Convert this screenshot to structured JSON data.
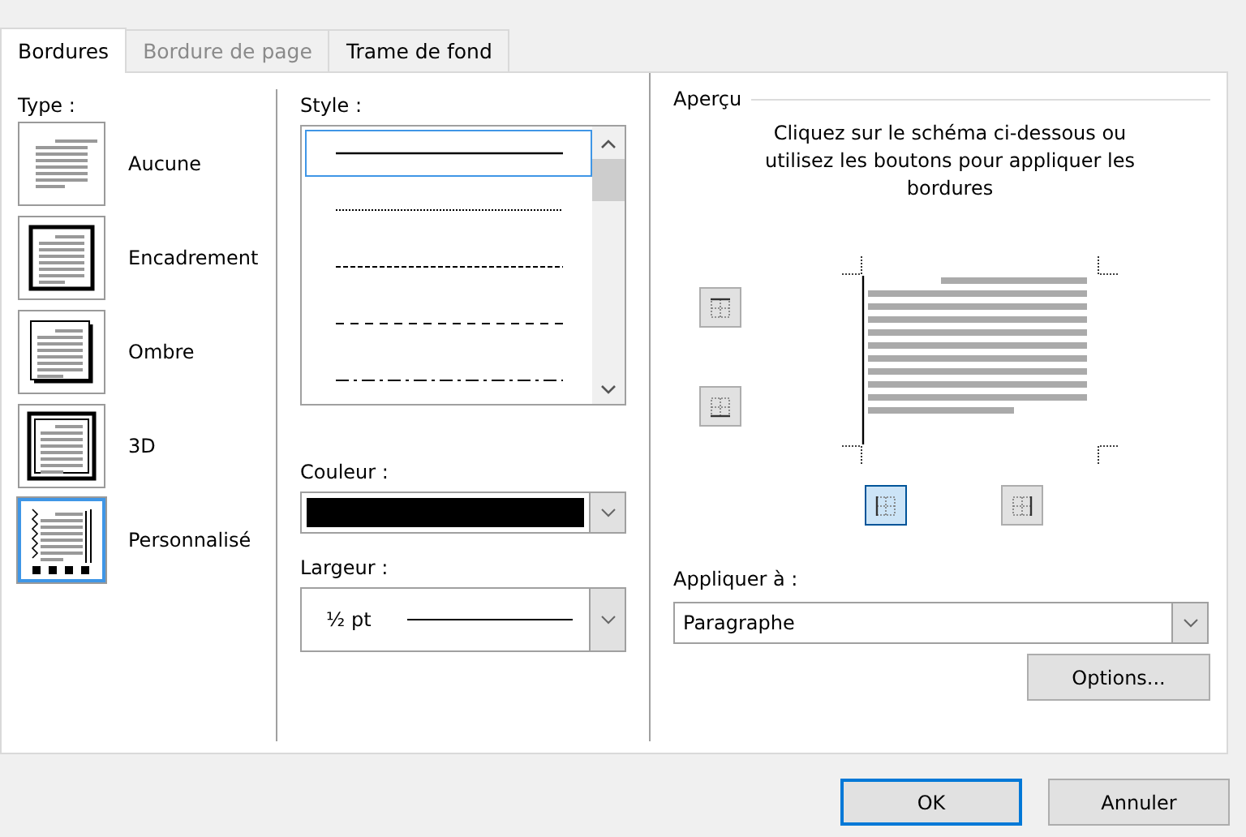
{
  "tabs": [
    {
      "label": "Bordures",
      "selected": true,
      "disabled": false
    },
    {
      "label": "Bordure de page",
      "selected": false,
      "disabled": true
    },
    {
      "label": "Trame de fond",
      "selected": false,
      "disabled": false
    }
  ],
  "type": {
    "label": "Type :",
    "items": [
      {
        "label": "Aucune",
        "kind": "none",
        "selected": false
      },
      {
        "label": "Encadrement",
        "kind": "box",
        "selected": false
      },
      {
        "label": "Ombre",
        "kind": "shadow",
        "selected": false
      },
      {
        "label": "3D",
        "kind": "threed",
        "selected": false
      },
      {
        "label": "Personnalisé",
        "kind": "custom",
        "selected": true
      }
    ]
  },
  "style": {
    "label": "Style :",
    "items": [
      {
        "kind": "solid",
        "selected": true
      },
      {
        "kind": "dotted",
        "selected": false
      },
      {
        "kind": "dashed-fine",
        "selected": false
      },
      {
        "kind": "dashed",
        "selected": false
      },
      {
        "kind": "dash-dot",
        "selected": false
      }
    ]
  },
  "color": {
    "label": "Couleur :",
    "color": "#000000"
  },
  "width": {
    "label": "Largeur :",
    "value": "½ pt"
  },
  "preview": {
    "title": "Aperçu",
    "instructions": "Cliquez sur le schéma ci-dessous ou utilisez les boutons pour appliquer les bordures",
    "buttons": [
      {
        "kind": "top",
        "selected": false
      },
      {
        "kind": "bottom",
        "selected": false
      },
      {
        "kind": "left",
        "selected": true
      },
      {
        "kind": "right",
        "selected": false
      }
    ]
  },
  "apply": {
    "label": "Appliquer à :",
    "value": "Paragraphe"
  },
  "options_button": "Options...",
  "buttons": [
    {
      "label": "OK",
      "default": true
    },
    {
      "label": "Annuler",
      "default": false
    }
  ]
}
